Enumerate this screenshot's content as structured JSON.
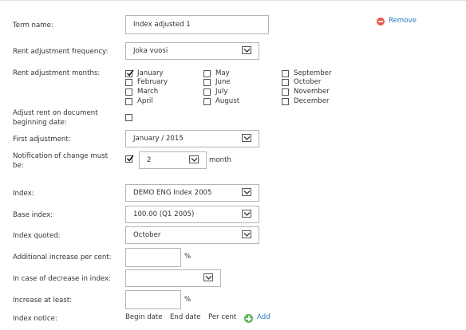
{
  "form": {
    "term_name_label": "Term name:",
    "term_name_value": "Index adjusted 1",
    "remove_label": "Remove",
    "frequency_label": "Rent adjustment frequency:",
    "frequency_value": "Joka vuosi",
    "months_label": "Rent adjustment months:",
    "months": [
      {
        "name": "January",
        "checked": true
      },
      {
        "name": "February",
        "checked": false
      },
      {
        "name": "March",
        "checked": false
      },
      {
        "name": "April",
        "checked": false
      },
      {
        "name": "May",
        "checked": false
      },
      {
        "name": "June",
        "checked": false
      },
      {
        "name": "July",
        "checked": false
      },
      {
        "name": "August",
        "checked": false
      },
      {
        "name": "September",
        "checked": false
      },
      {
        "name": "October",
        "checked": false
      },
      {
        "name": "November",
        "checked": false
      },
      {
        "name": "December",
        "checked": false
      }
    ],
    "adjust_begin_label": "Adjust rent on document beginning date:",
    "adjust_begin_checked": false,
    "first_adjustment_label": "First adjustment:",
    "first_adjustment_value": "January / 2015",
    "notification_label": "Notification of change must be:",
    "notification_checked": true,
    "notification_value": "2",
    "notification_unit": "month",
    "index_label": "Index:",
    "index_value": "DEMO ENG Index 2005",
    "base_index_label": "Base index:",
    "base_index_value": "100.00 (Q1 2005)",
    "index_quoted_label": "Index quoted:",
    "index_quoted_value": "October",
    "additional_increase_label": "Additional increase per cent:",
    "additional_increase_value": "",
    "percent_unit": "%",
    "decrease_label": "In case of decrease in index:",
    "decrease_value": "",
    "increase_at_least_label": "Increase at least:",
    "increase_at_least_value": "",
    "index_notice_label": "Index notice:",
    "notice_columns": [
      "Begin date",
      "End date",
      "Per cent"
    ],
    "add_label": "Add"
  },
  "colors": {
    "link": "#2b78c5",
    "remove_icon": "#e8574c",
    "add_icon": "#5cb85c"
  }
}
